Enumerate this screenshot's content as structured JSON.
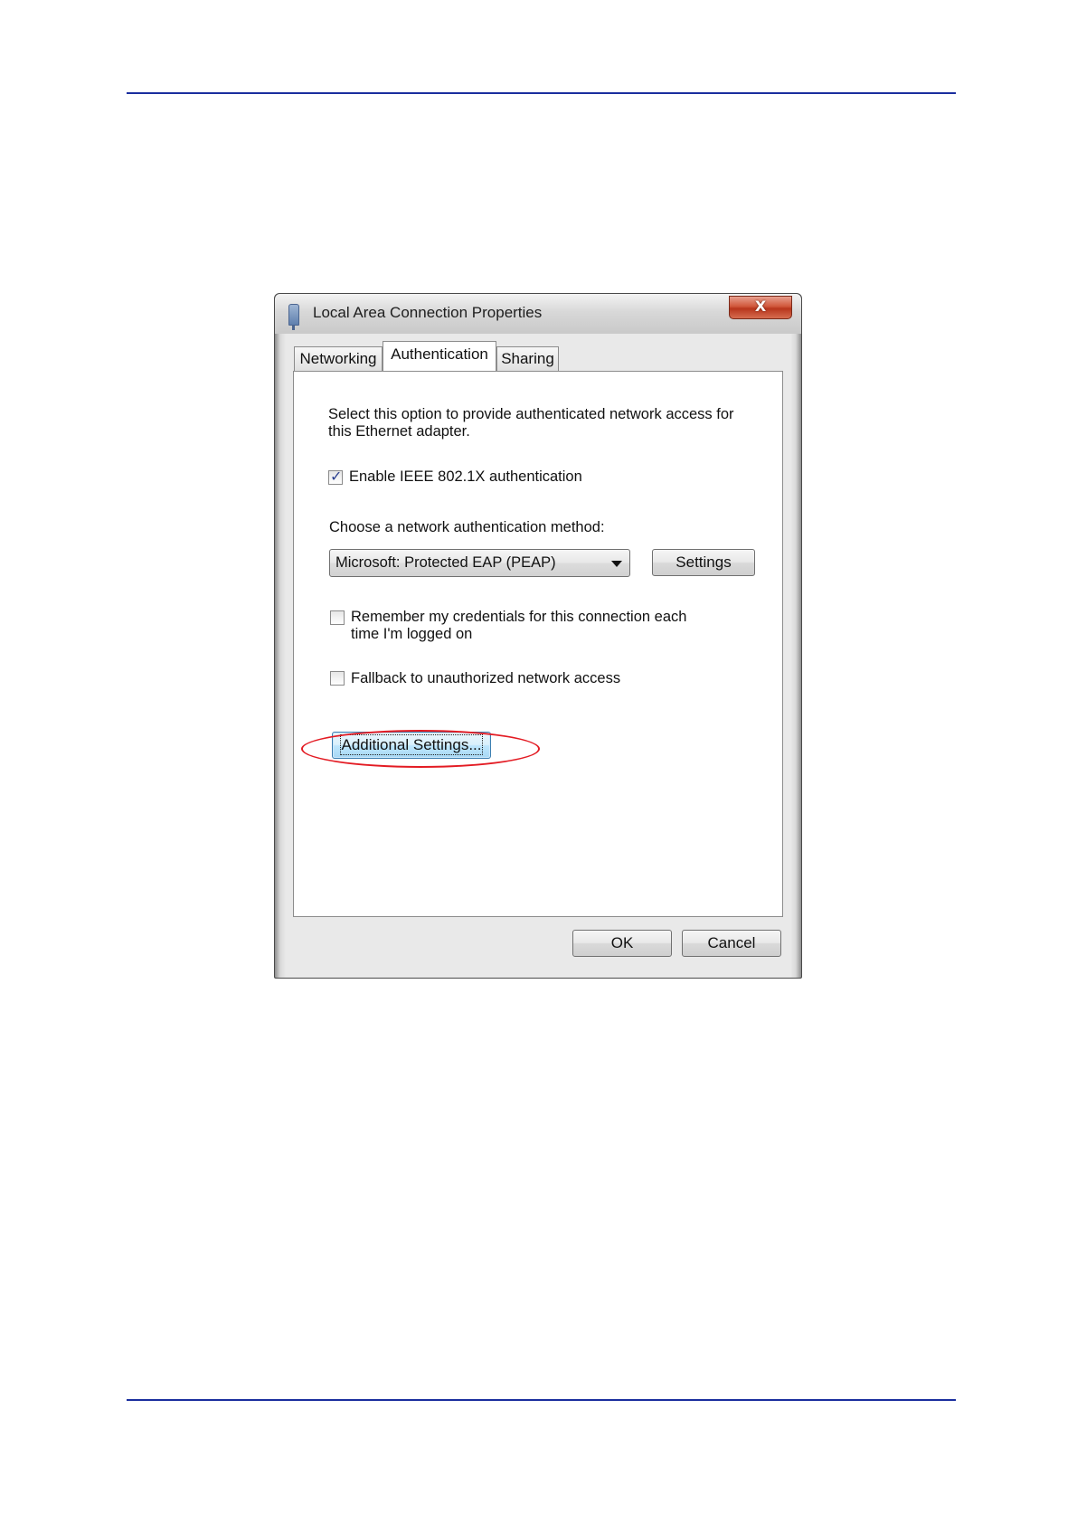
{
  "window": {
    "title": "Local Area Connection Properties",
    "close_label": "X"
  },
  "tabs": [
    {
      "label": "Networking",
      "active": false
    },
    {
      "label": "Authentication",
      "active": true
    },
    {
      "label": "Sharing",
      "active": false
    }
  ],
  "panel": {
    "description_line1": "Select this option to provide authenticated network access for",
    "description_line2": "this Ethernet adapter.",
    "enable_ieee": {
      "label": "Enable IEEE 802.1X authentication",
      "checked": true
    },
    "method_label": "Choose a network authentication method:",
    "method_select": {
      "value": "Microsoft: Protected EAP (PEAP)"
    },
    "settings_button": "Settings",
    "remember_credentials": {
      "line1": "Remember my credentials for this connection each",
      "line2": "time I'm logged on",
      "checked": false
    },
    "fallback": {
      "label": "Fallback to unauthorized network access",
      "checked": false
    },
    "additional_settings_button": "Additional Settings..."
  },
  "footer": {
    "ok_button": "OK",
    "cancel_button": "Cancel"
  },
  "colors": {
    "rule": "#1a2e9e",
    "highlight": "#e31b23"
  }
}
